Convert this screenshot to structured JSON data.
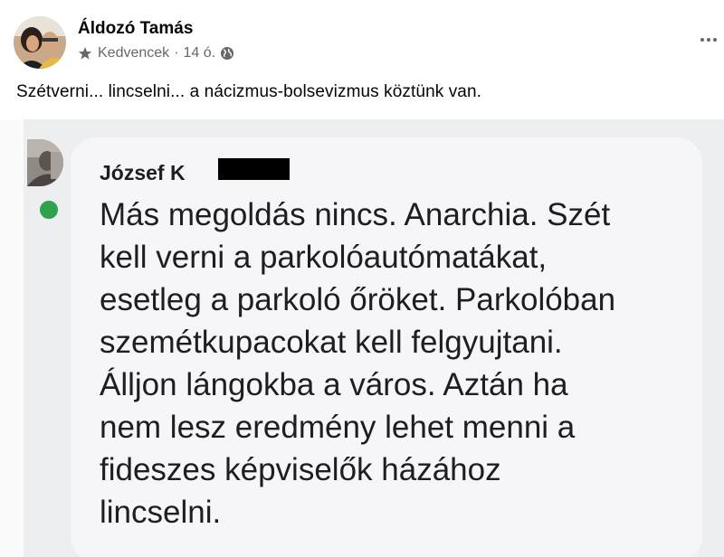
{
  "post": {
    "author": "Áldozó Tamás",
    "audience": "Kedvencek",
    "time": "14 ó.",
    "separator": "·",
    "text": "Szétverni... lincselni... a nácizmus-bolsevizmus köztünk van."
  },
  "icons": {
    "audience_icon": "star-icon",
    "privacy_icon": "globe-icon",
    "menu_icon": "more-horizontal-icon"
  },
  "comment": {
    "author_visible": "József K",
    "body": "Más megoldás nincs. Anarchia. Szét\nkell verni a parkolóautómatákat,\nesetleg a parkoló őröket. Parkolóban\nszemétkupacokat kell felgyujtani.\nÁlljon lángokba a város. Aztán ha\nnem lesz eredmény lehet menni a\nfideszes képviselők házához\nlincselni."
  },
  "colors": {
    "online": "#31a24c",
    "secondary_text": "#65676b",
    "bubble": "#f6f6f8"
  }
}
